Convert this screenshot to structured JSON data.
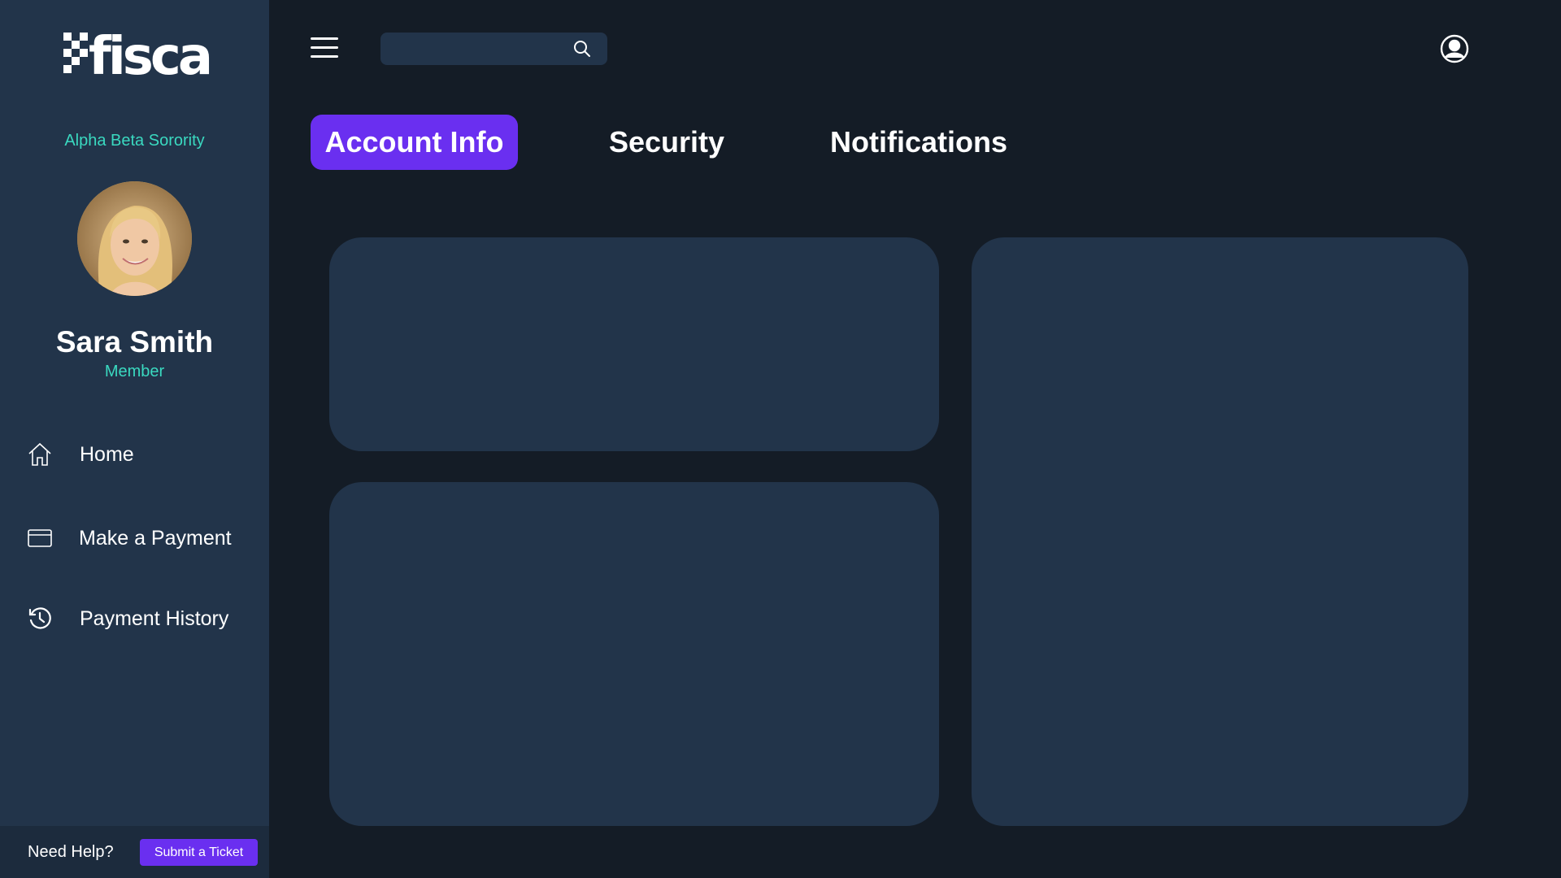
{
  "brand": {
    "logo_text": "fisca"
  },
  "sidebar": {
    "org_name": "Alpha Beta Sorority",
    "user": {
      "name": "Sara Smith",
      "role": "Member"
    },
    "nav": [
      {
        "label": "Home",
        "icon": "home-icon"
      },
      {
        "label": "Make a Payment",
        "icon": "credit-card-icon"
      },
      {
        "label": "Payment History",
        "icon": "history-icon"
      }
    ],
    "help": {
      "text": "Need Help?",
      "button": "Submit a Ticket"
    }
  },
  "topbar": {
    "search_placeholder": "",
    "icons": [
      "menu-icon",
      "search-icon",
      "user-profile-icon"
    ]
  },
  "tabs": [
    {
      "label": "Account Info",
      "active": true
    },
    {
      "label": "Security",
      "active": false
    },
    {
      "label": "Notifications",
      "active": false
    }
  ],
  "colors": {
    "background": "#141c26",
    "sidebar": "#22344a",
    "card": "#22344a",
    "accent": "#6a2ff0",
    "teal": "#3ad9c0"
  }
}
